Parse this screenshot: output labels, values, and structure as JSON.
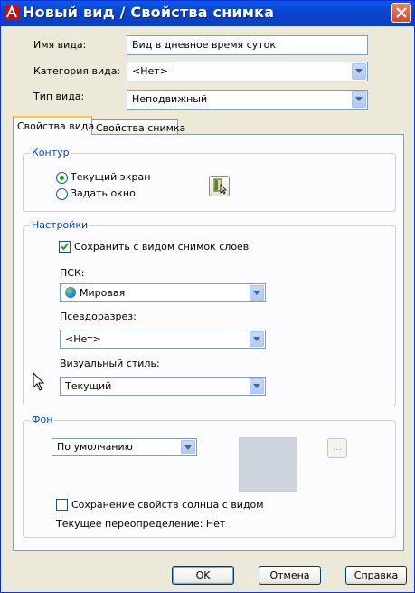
{
  "window": {
    "title": "Новый вид / Свойства снимка"
  },
  "fields": {
    "view_name": {
      "label": "Имя вида:",
      "value": "Вид в дневное время суток"
    },
    "view_category": {
      "label": "Категория вида:",
      "value": "<Нет>"
    },
    "view_type": {
      "label": "Тип вида:",
      "value": "Неподвижный"
    }
  },
  "tabs": [
    {
      "label": "Свойства вида",
      "active": true
    },
    {
      "label": "Свойства снимка",
      "active": false
    }
  ],
  "boundary": {
    "legend": "Контур",
    "options": [
      {
        "label": "Текущий экран",
        "selected": true
      },
      {
        "label": "Задать окно",
        "selected": false
      }
    ]
  },
  "settings": {
    "legend": "Настройки",
    "save_layers": {
      "label": "Сохранить с видом снимок слоев",
      "checked": true
    },
    "ucs": {
      "label": "ПСК:",
      "value": "Мировая"
    },
    "section": {
      "label": "Псевдоразрез:",
      "value": "<Нет>"
    },
    "visual_style": {
      "label": "Визуальный стиль:",
      "value": "Текущий"
    }
  },
  "background": {
    "legend": "Фон",
    "value": "По умолчанию",
    "ellipsis": "...",
    "sun": {
      "label": "Сохранение свойств солнца с видом",
      "checked": false
    },
    "override_text": "Текущее переопределение: Нет"
  },
  "buttons": {
    "ok": "OK",
    "cancel": "Отмена",
    "help": "Справка"
  },
  "colors": {
    "titlebar": "#0a4fd8",
    "accent": "#0046d5",
    "dialog": "#ece9d8"
  }
}
